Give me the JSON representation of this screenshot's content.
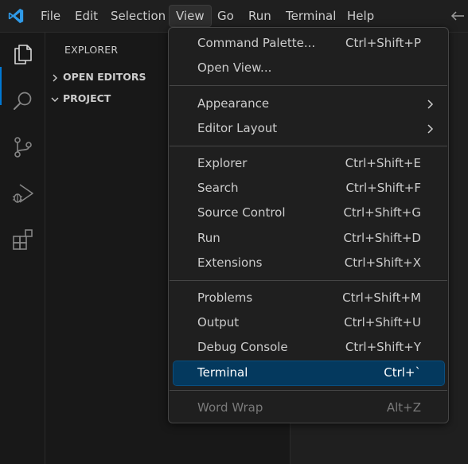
{
  "menubar": {
    "items": [
      {
        "label": "File"
      },
      {
        "label": "Edit"
      },
      {
        "label": "Selection"
      },
      {
        "label": "View"
      },
      {
        "label": "Go"
      },
      {
        "label": "Run"
      },
      {
        "label": "Terminal"
      },
      {
        "label": "Help"
      }
    ],
    "active": "View"
  },
  "activitybar": {
    "icons": [
      "explorer-icon",
      "search-icon",
      "source-control-icon",
      "run-debug-icon",
      "extensions-icon"
    ],
    "accent": "#0078d4"
  },
  "sidebar": {
    "title": "EXPLORER",
    "sections": [
      {
        "label": "OPEN EDITORS",
        "expanded": false
      },
      {
        "label": "PROJECT",
        "expanded": true
      }
    ]
  },
  "view_menu": {
    "groups": [
      [
        {
          "label": "Command Palette...",
          "shortcut": "Ctrl+Shift+P"
        },
        {
          "label": "Open View...",
          "shortcut": ""
        }
      ],
      [
        {
          "label": "Appearance",
          "submenu": true
        },
        {
          "label": "Editor Layout",
          "submenu": true
        }
      ],
      [
        {
          "label": "Explorer",
          "shortcut": "Ctrl+Shift+E"
        },
        {
          "label": "Search",
          "shortcut": "Ctrl+Shift+F"
        },
        {
          "label": "Source Control",
          "shortcut": "Ctrl+Shift+G"
        },
        {
          "label": "Run",
          "shortcut": "Ctrl+Shift+D"
        },
        {
          "label": "Extensions",
          "shortcut": "Ctrl+Shift+X"
        }
      ],
      [
        {
          "label": "Problems",
          "shortcut": "Ctrl+Shift+M"
        },
        {
          "label": "Output",
          "shortcut": "Ctrl+Shift+U"
        },
        {
          "label": "Debug Console",
          "shortcut": "Ctrl+Shift+Y"
        },
        {
          "label": "Terminal",
          "shortcut": "Ctrl+`",
          "highlighted": true
        }
      ],
      [
        {
          "label": "Word Wrap",
          "shortcut": "Alt+Z",
          "disabled": true
        }
      ]
    ],
    "highlight_color": "#04395e"
  }
}
